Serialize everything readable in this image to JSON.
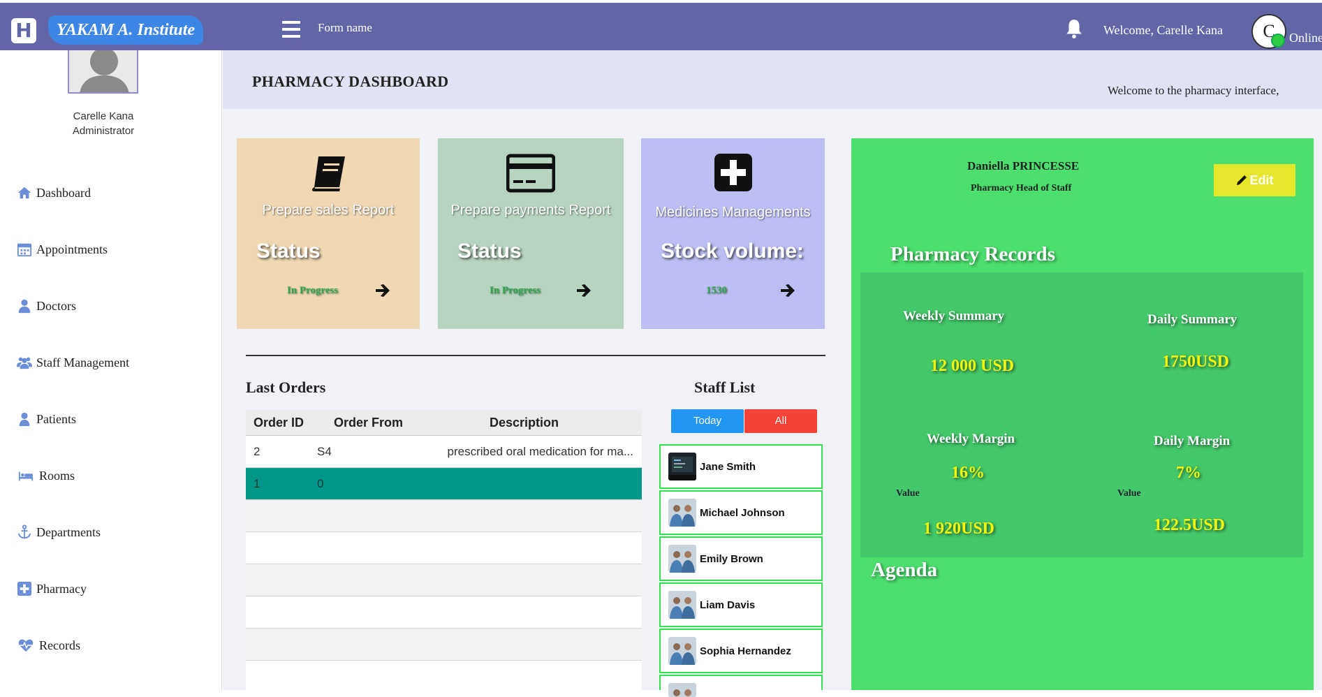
{
  "topbar": {
    "logo_letter": "H",
    "brand": "YAKAM A. Institute",
    "form_name": "Form name",
    "welcome": "Welcome, Carelle Kana",
    "avatar_letter": "C",
    "status": "Online"
  },
  "sidebar": {
    "user_name": "Carelle Kana",
    "user_role": "Administrator",
    "items": [
      {
        "label": "Dashboard",
        "icon": "home-icon"
      },
      {
        "label": "Appointments",
        "icon": "calendar-icon"
      },
      {
        "label": "Doctors",
        "icon": "doctor-icon"
      },
      {
        "label": "Staff Management",
        "icon": "users-icon"
      },
      {
        "label": "Patients",
        "icon": "user-icon"
      },
      {
        "label": "Rooms",
        "icon": "bed-icon"
      },
      {
        "label": "Departments",
        "icon": "anchor-icon"
      },
      {
        "label": "Pharmacy",
        "icon": "plus-square-icon"
      },
      {
        "label": "Records",
        "icon": "heartbeat-icon"
      }
    ]
  },
  "header": {
    "title": "PHARMACY DASHBOARD",
    "welcome": "Welcome to the pharmacy interface,"
  },
  "cards": [
    {
      "caption": "Prepare sales Report",
      "big": "Status",
      "status": "In Progress",
      "icon": "book-icon",
      "bg": "#efd8b2"
    },
    {
      "caption": "Prepare payments Report",
      "big": "Status",
      "status": "In Progress",
      "icon": "credit-card-icon",
      "bg": "#b6d4c0"
    },
    {
      "caption": "Medicines Managements",
      "big": "Stock volume:",
      "status": "1530",
      "icon": "plus-square-icon",
      "bg": "#bdbef4"
    }
  ],
  "orders": {
    "title": "Last Orders",
    "columns": [
      "Order ID",
      "Order From",
      "Description"
    ],
    "rows": [
      {
        "id": "2",
        "from": "S4",
        "description": "prescribed oral medication for ma..."
      },
      {
        "id": "1",
        "from": "0",
        "description": ""
      }
    ]
  },
  "staff": {
    "title": "Staff List",
    "filter_today": "Today",
    "filter_all": "All",
    "members": [
      "Jane Smith",
      "Michael Johnson",
      "Emily Brown",
      "Liam Davis",
      "Sophia Hernandez"
    ]
  },
  "panel": {
    "name": "Daniella PRINCESSE",
    "role": "Pharmacy Head of Staff",
    "edit_label": "Edit",
    "records_title": "Pharmacy Records",
    "weekly_summary_label": "Weekly Summary",
    "weekly_summary_value": "12 000 USD",
    "daily_summary_label": "Daily Summary",
    "daily_summary_value": "1750USD",
    "weekly_margin_label": "Weekly Margin",
    "weekly_margin_value": "16%",
    "daily_margin_label": "Daily Margin",
    "daily_margin_value": "7%",
    "value_label": "Value",
    "weekly_value": "1 920USD",
    "daily_value": "122.5USD",
    "agenda_title": "Agenda"
  },
  "colors": {
    "topbar": "#6366a6",
    "brand_bg": "#3d86e6",
    "panel_green": "#4cdf6e",
    "selected_row": "#009688",
    "today_btn": "#2196f3",
    "all_btn": "#f44336",
    "edit_btn": "#e6e62b"
  }
}
